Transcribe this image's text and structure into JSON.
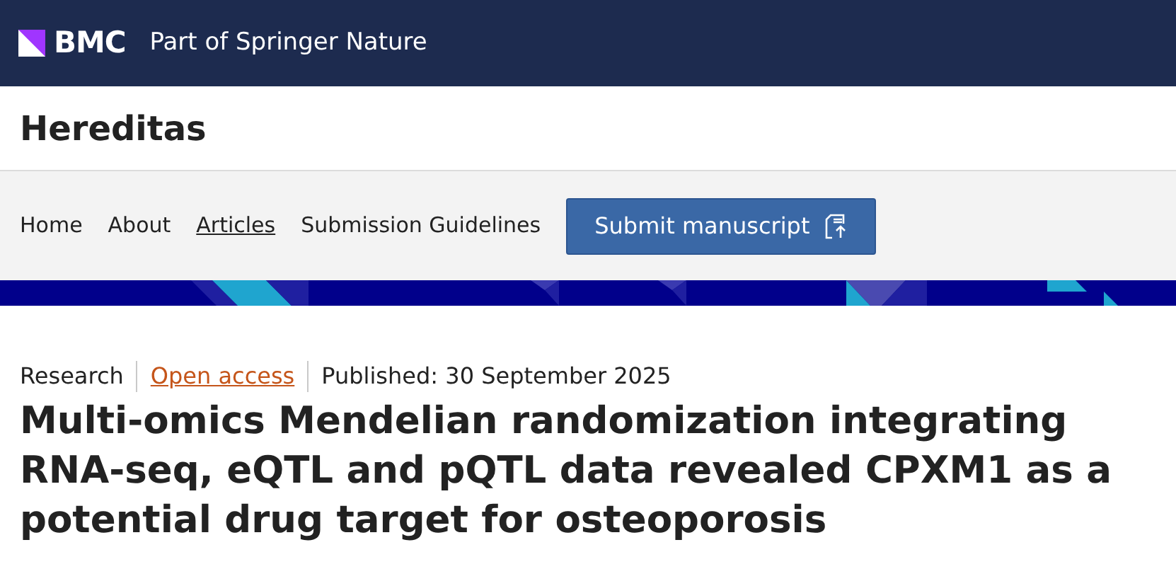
{
  "header": {
    "logo": "BMC",
    "tagline": "Part of Springer Nature"
  },
  "journal": {
    "title": "Hereditas"
  },
  "nav": {
    "items": [
      {
        "label": "Home",
        "selected": false
      },
      {
        "label": "About",
        "selected": false
      },
      {
        "label": "Articles",
        "selected": true
      },
      {
        "label": "Submission Guidelines",
        "selected": false
      }
    ],
    "button": "Submit manuscript"
  },
  "article": {
    "type": "Research",
    "access": "Open access",
    "published": "Published: 30 September 2025",
    "title": "Multi-omics Mendelian randomization integrating RNA-seq, eQTL and pQTL data revealed CPXM1 as a potential drug target for osteoporosis"
  }
}
